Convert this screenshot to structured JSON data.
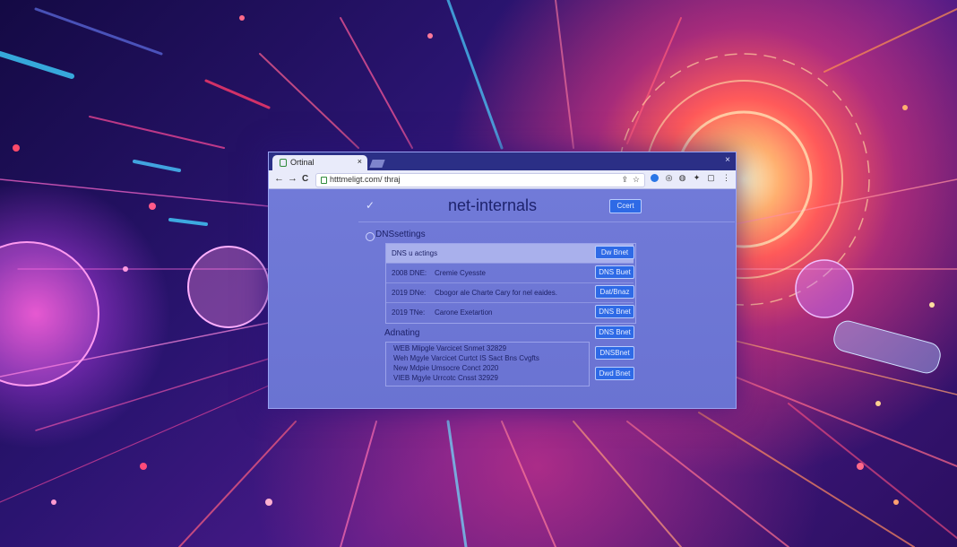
{
  "browser": {
    "tab_title": "Ortinal",
    "tab_close": "×",
    "window_close": "×",
    "back": "←",
    "forward": "→",
    "reload": "C",
    "url": "htttmeligt.com/ thraj"
  },
  "page": {
    "title": "net-internals",
    "header_button": "Ccert",
    "dns_section": {
      "title": "DNSsettings",
      "rows": [
        {
          "col1": "DNS u actings",
          "col2": "",
          "button": "Dw Bnet"
        },
        {
          "col1": "2008 DNE:",
          "col2": "Cremie Cyesste",
          "button": "DNS Buet"
        },
        {
          "col1": "2019 DNe:",
          "col2": "Cbogor ale Charte Cary for nel eaides.",
          "button": "Dat/Bnaz"
        },
        {
          "col1": "2019 TNe:",
          "col2": "Carone Exetartion",
          "button": "DNS Bnet"
        }
      ]
    },
    "advanced_section": {
      "title": "Adnating",
      "lines": [
        "WEB Mlipgle Varcicet Snmet 32829",
        "Weh Mgyle Varcicet Curtct IS Sact Bns Cvgfts",
        "New Mdpie Umsocre Conct 2020",
        "VIEB Mgyle Urrcotc Cnsst 32929"
      ],
      "buttons": [
        "DNS Bnet",
        "DNSBnet",
        "Dwd Bnet"
      ]
    }
  },
  "colors": {
    "window_bg": "#6f77d6",
    "tabbar": "#2b2f86",
    "button": "#2e6ae6",
    "title_text": "#1e236d"
  }
}
